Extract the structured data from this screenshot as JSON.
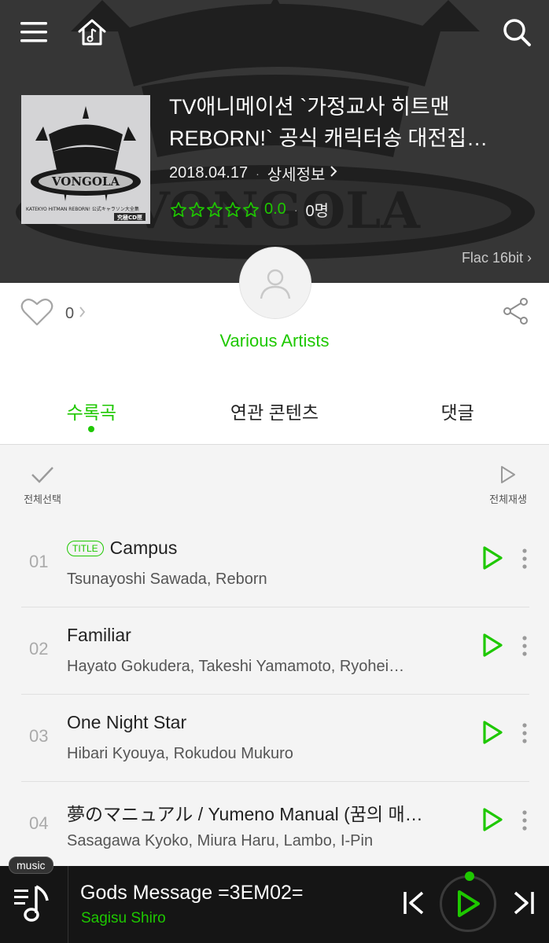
{
  "header": {
    "icons": [
      "menu-icon",
      "home-music-icon",
      "search-icon"
    ]
  },
  "album": {
    "title": "TV애니메이션 `가정교사 히트맨 REBORN!` 공식 캐릭터송 대전집…",
    "release_date": "2018.04.17",
    "detail_label": "상세정보",
    "rating_score": "0.0",
    "rating_count": "0명",
    "stars_filled": 0,
    "stars_total": 5,
    "quality": "Flac 16bit",
    "quality_chevron": "›",
    "cover_text": {
      "logo": "VONGOLA",
      "subtitle": "KATEKYO HITMAN REBORN! 公式キャラソン大全集",
      "badge": "究極CD匣"
    }
  },
  "social": {
    "like_count": "0",
    "artist": "Various Artists"
  },
  "tabs": [
    {
      "label": "수록곡",
      "active": true
    },
    {
      "label": "연관 콘텐츠",
      "active": false
    },
    {
      "label": "댓글",
      "active": false
    }
  ],
  "list_controls": {
    "select_all": "전체선택",
    "play_all": "전체재생"
  },
  "tracks": [
    {
      "num": "01",
      "title": "Campus",
      "badge": "TITLE",
      "artists": "Tsunayoshi Sawada, Reborn"
    },
    {
      "num": "02",
      "title": "Familiar",
      "badge": "",
      "artists": "Hayato Gokudera, Takeshi Yamamoto, Ryohei…"
    },
    {
      "num": "03",
      "title": "One Night Star",
      "badge": "",
      "artists": "Hibari Kyouya, Rokudou Mukuro"
    },
    {
      "num": "04",
      "title": "夢のマニュアル / Yumeno Manual (꿈의 매…",
      "badge": "",
      "artists": "Sasagawa Kyoko, Miura Haru, Lambo, I-Pin"
    }
  ],
  "player": {
    "tag": "music",
    "now_title": "Gods Message =3EM02=",
    "now_artist": "Sagisu Shiro"
  },
  "colors": {
    "accent": "#1ec800",
    "player_bg": "#151515",
    "list_bg": "#f4f4f4"
  }
}
